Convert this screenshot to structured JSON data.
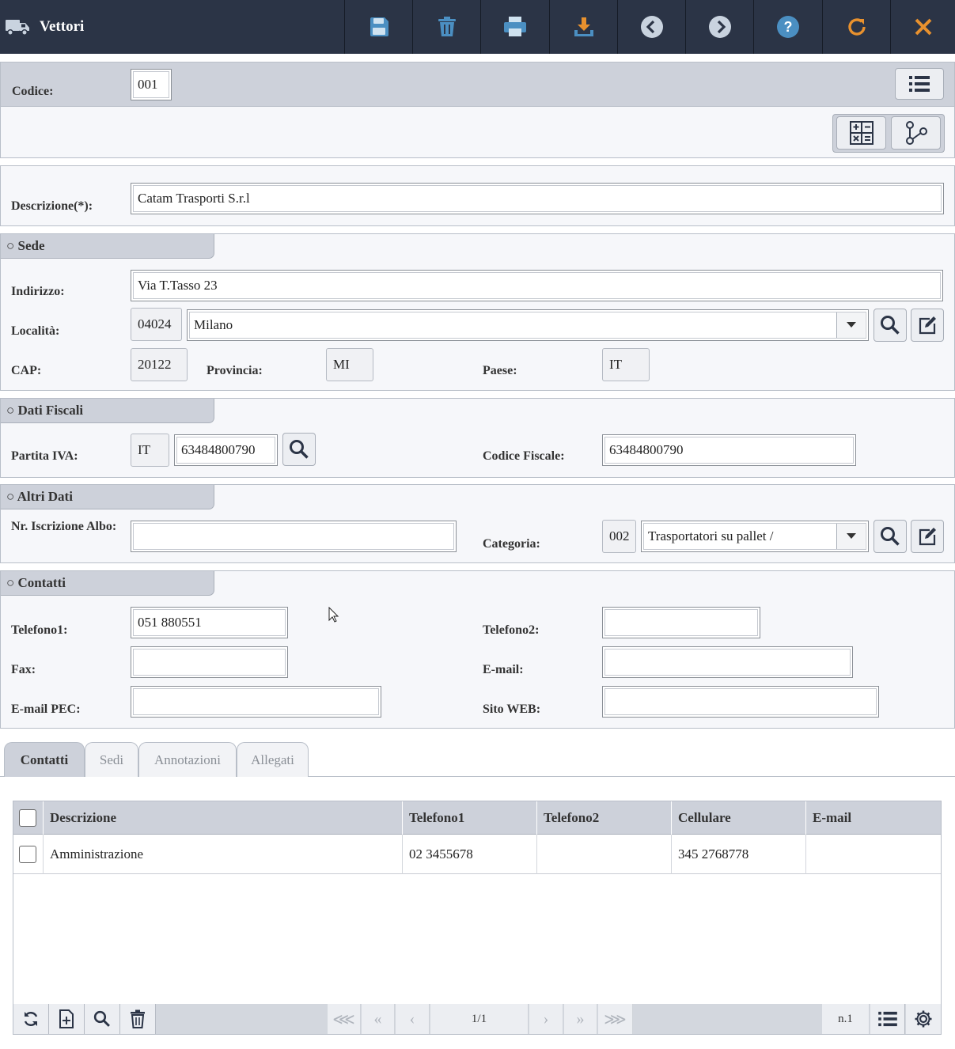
{
  "app": {
    "title": "Vettori"
  },
  "toolbar": {
    "buttons": [
      "save-icon",
      "trash-icon",
      "print-icon",
      "download-icon",
      "prev-icon",
      "next-icon",
      "help-icon",
      "refresh-icon",
      "close-icon"
    ]
  },
  "header": {
    "codice_label": "Codice:",
    "codice_value": "001"
  },
  "main": {
    "descrizione_label": "Descrizione(*):",
    "descrizione_value": "Catam Trasporti S.r.l"
  },
  "sede": {
    "title": "○ Sede",
    "indirizzo_label": "Indirizzo:",
    "indirizzo_value": "Via T.Tasso 23",
    "localita_label": "Località:",
    "localita_code": "04024",
    "localita_value": "Milano",
    "cap_label": "CAP:",
    "cap_value": "20122",
    "provincia_label": "Provincia:",
    "provincia_value": "MI",
    "paese_label": "Paese:",
    "paese_value": "IT"
  },
  "fiscali": {
    "title": "○ Dati Fiscali",
    "piva_label": "Partita IVA:",
    "piva_country": "IT",
    "piva_value": "63484800790",
    "cf_label": "Codice Fiscale:",
    "cf_value": "63484800790"
  },
  "altri": {
    "title": "○ Altri Dati",
    "albo_label": "Nr. Iscrizione Albo:",
    "albo_value": "",
    "categoria_label": "Categoria:",
    "categoria_code": "002",
    "categoria_value": "Trasportatori su pallet /"
  },
  "contatti": {
    "title": "○ Contatti",
    "tel1_label": "Telefono1:",
    "tel1_value": "051 880551",
    "tel2_label": "Telefono2:",
    "tel2_value": "",
    "fax_label": "Fax:",
    "fax_value": "",
    "email_label": "E-mail:",
    "email_value": "",
    "pec_label": "E-mail PEC:",
    "pec_value": "",
    "web_label": "Sito WEB:",
    "web_value": ""
  },
  "tabs": [
    {
      "label": "Contatti",
      "active": true
    },
    {
      "label": "Sedi"
    },
    {
      "label": "Annotazioni"
    },
    {
      "label": "Allegati"
    }
  ],
  "grid": {
    "columns": [
      "Descrizione",
      "Telefono1",
      "Telefono2",
      "Cellulare",
      "E-mail"
    ],
    "rows": [
      {
        "descrizione": "Amministrazione",
        "telefono1": "02 3455678",
        "telefono2": "",
        "cellulare": "345 2768778",
        "email": ""
      }
    ],
    "pager": {
      "page": "1/1",
      "count": "n.1"
    }
  },
  "colors": {
    "topbar": "#2b3446",
    "accent_blue": "#4b8fc2",
    "accent_orange": "#e8912e",
    "section": "#cdd1da"
  }
}
